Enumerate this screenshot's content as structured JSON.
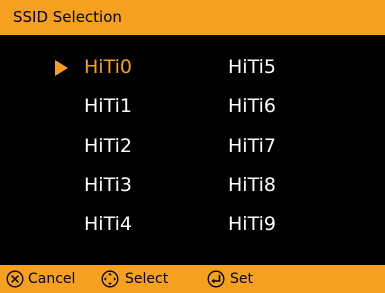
{
  "title_bar": {
    "title": "SSID Selection"
  },
  "ssid_list": {
    "selected": "HiTi0",
    "column_left": [
      "HiTi0",
      "HiTi1",
      "HiTi2",
      "HiTi3",
      "HiTi4"
    ],
    "column_right": [
      "HiTi5",
      "HiTi6",
      "HiTi7",
      "HiTi8",
      "HiTi9"
    ]
  },
  "footer": {
    "cancel_label": "Cancel",
    "cancel_icon": "circle-x-icon",
    "select_label": "Select",
    "select_icon": "dpad-icon",
    "set_label": "Set",
    "set_icon": "enter-icon"
  },
  "colors": {
    "accent": "#f5a01f",
    "background": "#000000",
    "text": "#ffffff"
  }
}
